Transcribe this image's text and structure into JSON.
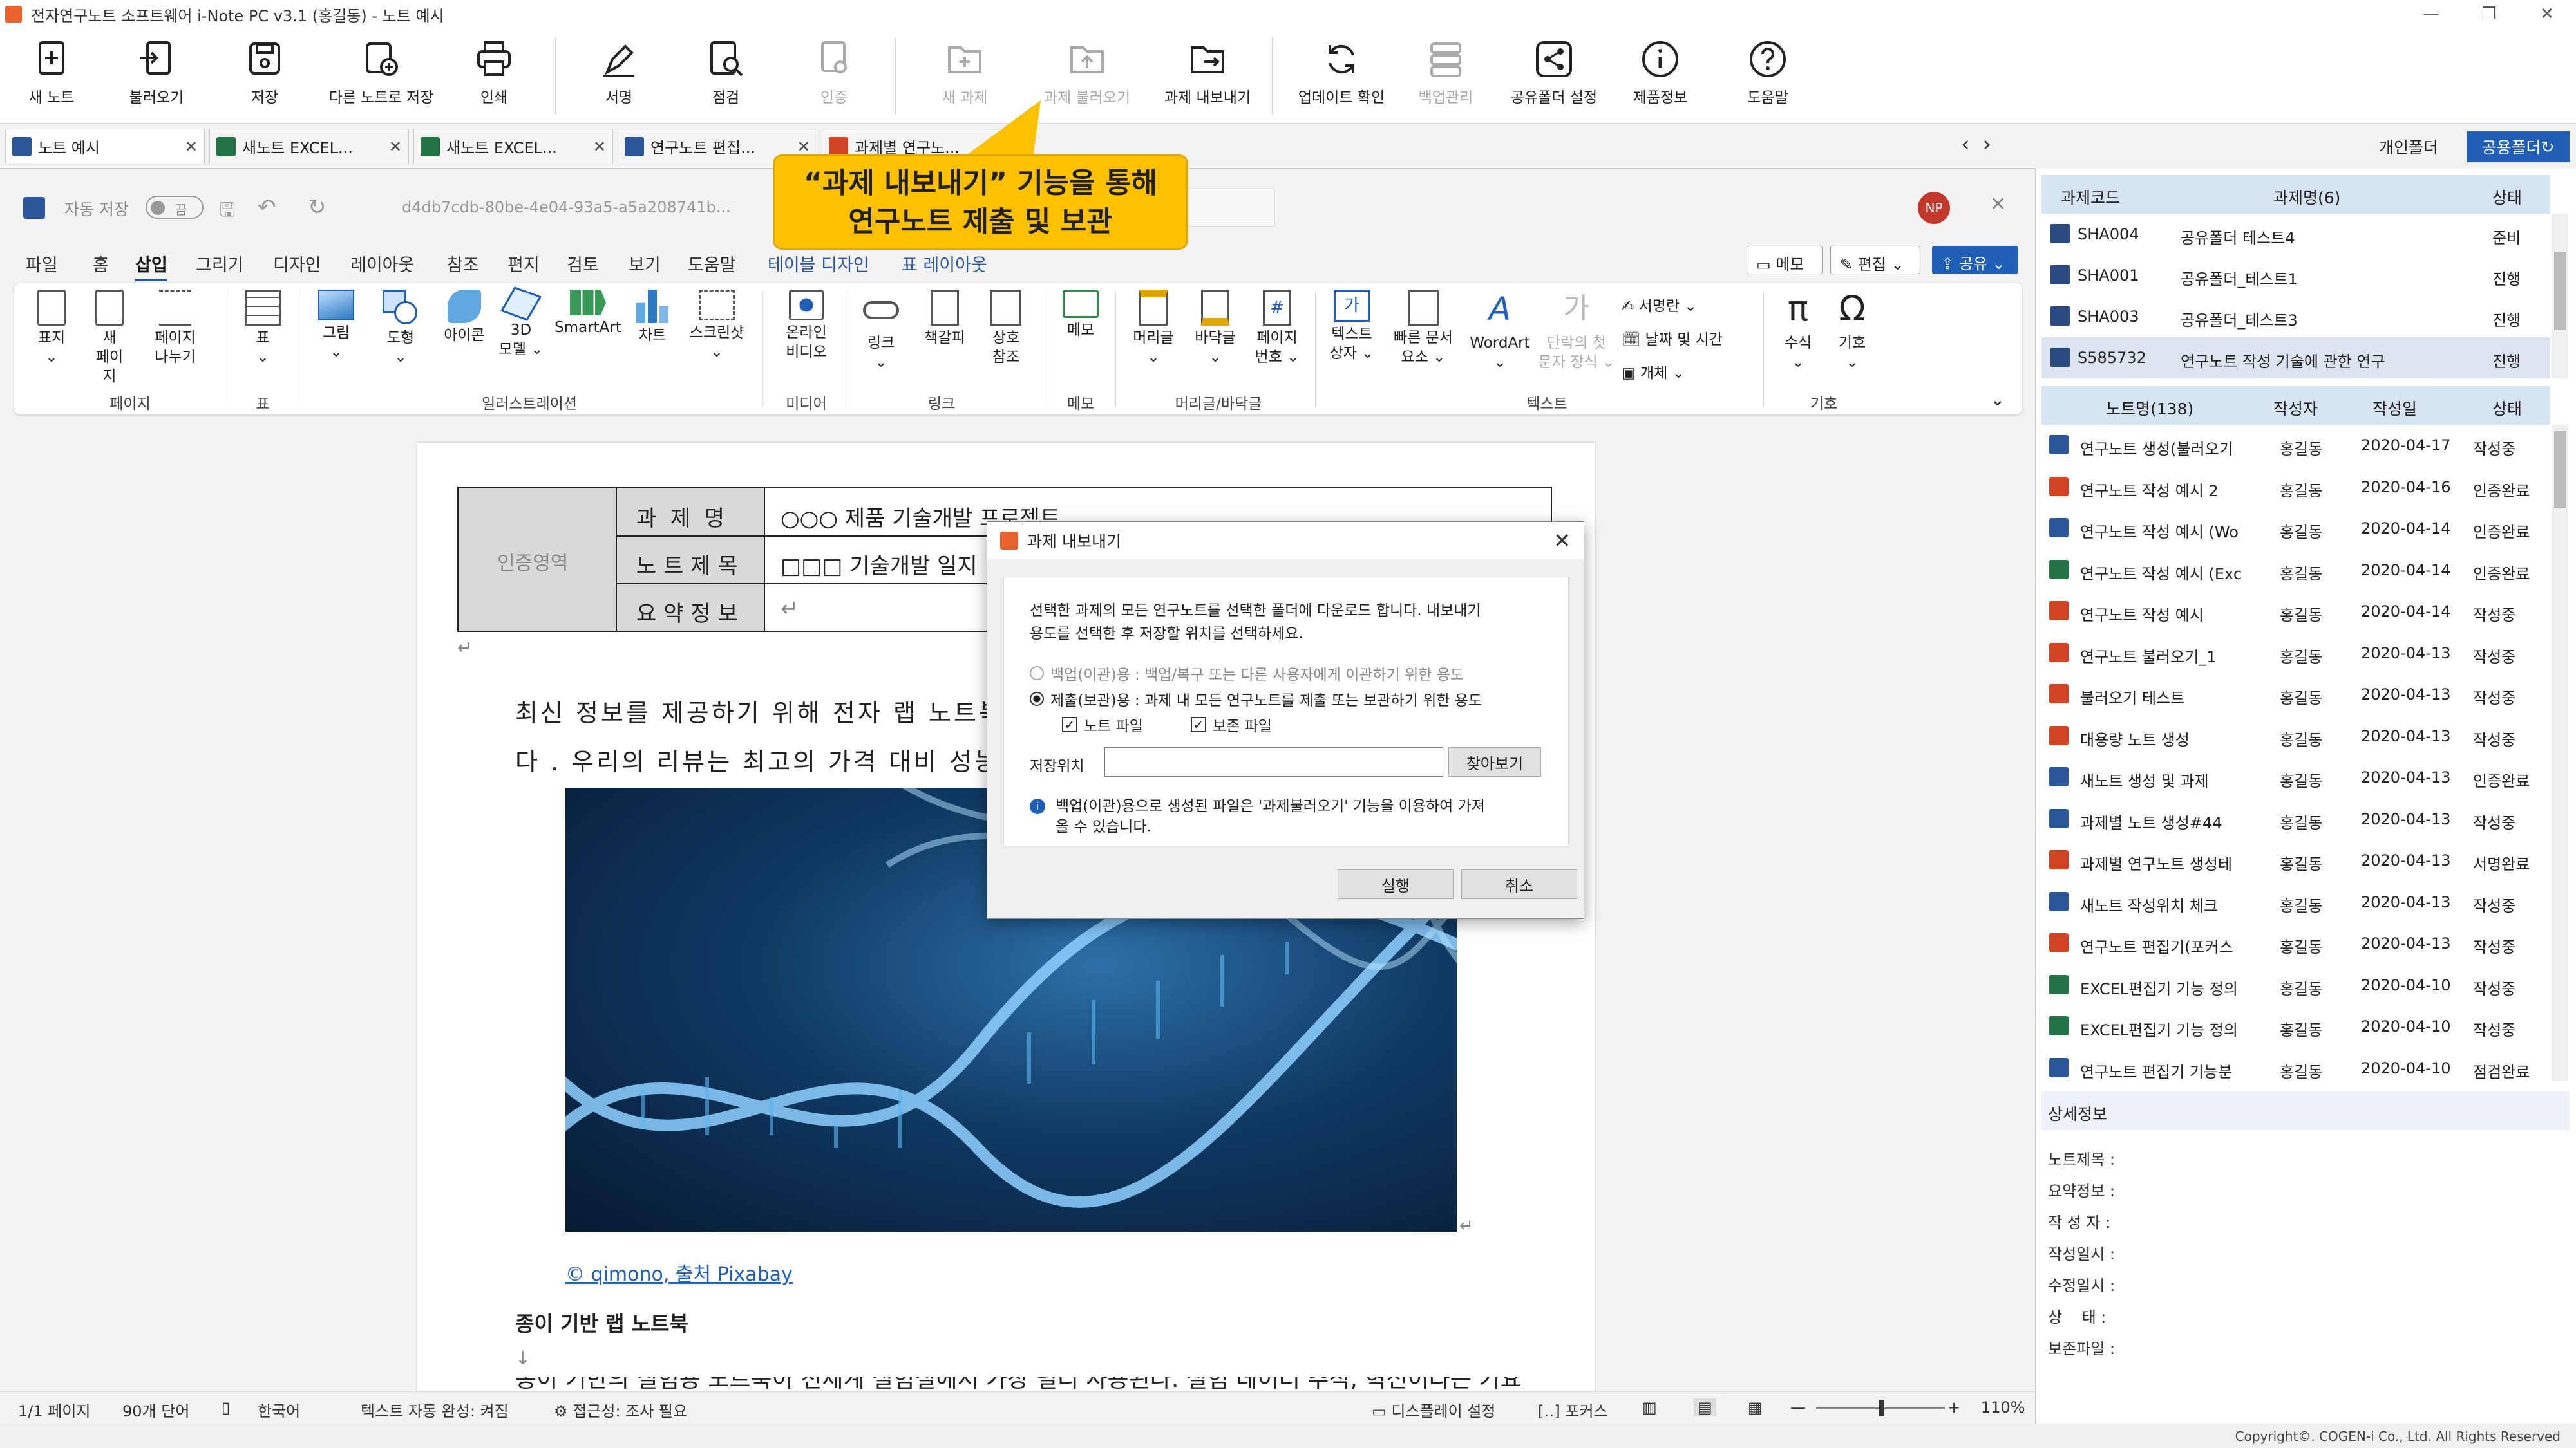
{
  "window": {
    "title": "전자연구노트 소프트웨어 i-Note PC v3.1 (홍길동) - 노트 예시",
    "minimize": "—",
    "maximize": "❐",
    "close": "✕"
  },
  "toolbar": {
    "buttons": [
      {
        "label": "새 노트",
        "icon": "new-note-icon"
      },
      {
        "label": "불러오기",
        "icon": "import-icon"
      },
      {
        "label": "저장",
        "icon": "save-icon"
      },
      {
        "label": "다른 노트로 저장",
        "icon": "save-as-icon"
      },
      {
        "label": "인쇄",
        "icon": "print-icon"
      },
      {
        "label": "서명",
        "icon": "sign-icon"
      },
      {
        "label": "점검",
        "icon": "inspect-icon"
      },
      {
        "label": "인증",
        "icon": "certify-icon"
      },
      {
        "label": "새 과제",
        "icon": "new-project-icon"
      },
      {
        "label": "과제 불러오기",
        "icon": "import-project-icon"
      },
      {
        "label": "과제 내보내기",
        "icon": "export-project-icon"
      },
      {
        "label": "업데이트 확인",
        "icon": "update-icon"
      },
      {
        "label": "백업관리",
        "icon": "backup-icon"
      },
      {
        "label": "공유폴더 설정",
        "icon": "share-icon"
      },
      {
        "label": "제품정보",
        "icon": "info-icon"
      },
      {
        "label": "도움말",
        "icon": "help-icon"
      }
    ]
  },
  "callout": {
    "line1": "“과제 내보내기” 기능을 통해",
    "line2": "연구노트 제출 및 보관"
  },
  "tabs": [
    {
      "label": "노트 예시",
      "type": "word"
    },
    {
      "label": "새노트 EXCEL...",
      "type": "excel"
    },
    {
      "label": "새노트 EXCEL...",
      "type": "excel"
    },
    {
      "label": "연구노트 편집...",
      "type": "word"
    },
    {
      "label": "과제별 연구노...",
      "type": "ppt"
    }
  ],
  "word": {
    "autosave_label": "자동 저장",
    "autosave_state": "끔",
    "filename": "d4db7cdb-80be-4e04-93a5-a5a208741b...",
    "avatar": "NP",
    "ribbon_tabs": [
      "파일",
      "홈",
      "삽입",
      "그리기",
      "디자인",
      "레이아웃",
      "참조",
      "편지",
      "검토",
      "보기",
      "도움말",
      "테이블 디자인",
      "표 레이아웃"
    ],
    "memo_btn": "메모",
    "edit_btn": "편집",
    "share_btn": "공유",
    "ribbon_groups": [
      "페이지",
      "표",
      "일러스트레이션",
      "미디어",
      "링크",
      "메모",
      "머리글/바닥글",
      "텍스트",
      "기호"
    ],
    "ribbon_items": {
      "cover": "표지",
      "new_page_1": "새",
      "new_page_2": "페이지",
      "page_break_1": "페이지",
      "page_break_2": "나누기",
      "table": "표",
      "picture": "그림",
      "shape": "도형",
      "icons": "아이콘",
      "model3d_1": "3D",
      "model3d_2": "모델",
      "smartart": "SmartArt",
      "chart": "차트",
      "screenshot": "스크린샷",
      "online_video_1": "온라인",
      "online_video_2": "비디오",
      "link": "링크",
      "bookmark": "책갈피",
      "cross_ref_1": "상호",
      "cross_ref_2": "참조",
      "comment": "메모",
      "header": "머리글",
      "footer": "바닥글",
      "page_number_1": "페이지",
      "page_number_2": "번호",
      "textbox_1": "텍스트",
      "textbox_2": "상자",
      "quick_parts_1": "빠른 문서",
      "quick_parts_2": "요소",
      "wordart": "WordArt",
      "dropcap_1": "단락의 첫",
      "dropcap_2": "문자 장식",
      "signature": "서명란",
      "datetime": "날짜 및 시간",
      "object": "개체",
      "equation": "수식",
      "symbol": "기호"
    }
  },
  "document": {
    "table": {
      "left_label": "인증영역",
      "rows": [
        {
          "label": "과  제  명",
          "value": "○○○ 제품 기술개발 프로젝트"
        },
        {
          "label": "노 트 제 목",
          "value": "□□□ 기술개발 일지"
        },
        {
          "label": "요 약 정 보",
          "value": ""
        }
      ]
    },
    "paragraph_line1": "최신 정보를 제공하기 위해 전자 랩 노트북",
    "paragraph_line2": "다 . 우리의 리뷰는 최고의 가격 대비 성능을",
    "image_credit": "© qimono, 출처 Pixabay",
    "section_title": "종이 기반 랩 노트북",
    "para_mark": "↵",
    "para_mark_down": "↓",
    "cutoff_line": "종이 기반의 실험용 노트북이 전세계 실험실에서 가장 널리 사용된다. 실험 데이터 추적, 혁신이라는 기요"
  },
  "status_bar": {
    "page": "1/1 페이지",
    "words": "90개 단어",
    "language": "한국어",
    "autocomplete": "텍스트 자동 완성: 켜짐",
    "accessibility": "접근성: 조사 필요",
    "display_settings": "디스플레이 설정",
    "focus": "포커스",
    "zoom": "110%"
  },
  "dialog": {
    "title": "과제 내보내기",
    "close": "✕",
    "description_line1": "선택한 과제의 모든 연구노트를 선택한 폴더에 다운로드 합니다. 내보내기",
    "description_line2": "용도를 선택한 후 저장할 위치를 선택하세요.",
    "option_backup": "백업(이관)용 : 백업/복구 또는 다른 사용자에게 이관하기 위한 용도",
    "option_submit": "제출(보관)용 : 과제 내 모든 연구노트를 제출 또는 보관하기 위한 용도",
    "selected_option": "submit",
    "check_note_file": "노트 파일",
    "check_preserve_file": "보존 파일",
    "save_location_label": "저장위치",
    "save_location_value": "",
    "browse_button": "찾아보기",
    "info_line1": "백업(이관)용으로 생성된 파일은 '과제불러오기' 기능을 이용하여 가져",
    "info_line2": "올 수 있습니다.",
    "ok_button": "실행",
    "cancel_button": "취소"
  },
  "right_panel": {
    "tab_personal": "개인폴더",
    "tab_shared": "공용폴더",
    "projects_header": {
      "code": "과제코드",
      "name": "과제명(6)",
      "status": "상태"
    },
    "projects": [
      {
        "code": "SHA004",
        "name": "공유폴더 테스트4",
        "status": "준비"
      },
      {
        "code": "SHA001",
        "name": "공유폴더_테스트1",
        "status": "진행"
      },
      {
        "code": "SHA003",
        "name": "공유폴더_테스트3",
        "status": "진행"
      },
      {
        "code": "S585732",
        "name": "연구노트 작성 기술에 관한 연구",
        "status": "진행"
      }
    ],
    "notes_header": {
      "name": "노트명(138)",
      "author": "작성자",
      "date": "작성일",
      "status": "상태"
    },
    "notes": [
      {
        "type": "word",
        "name": "연구노트 생성(불러오기",
        "author": "홍길동",
        "date": "2020-04-17",
        "status": "작성중"
      },
      {
        "type": "ppt",
        "name": "연구노트 작성 예시 2",
        "author": "홍길동",
        "date": "2020-04-16",
        "status": "인증완료"
      },
      {
        "type": "word",
        "name": "연구노트 작성 예시 (Wo",
        "author": "홍길동",
        "date": "2020-04-14",
        "status": "인증완료"
      },
      {
        "type": "excel",
        "name": "연구노트 작성 예시 (Exc",
        "author": "홍길동",
        "date": "2020-04-14",
        "status": "인증완료"
      },
      {
        "type": "ppt",
        "name": "연구노트 작성 예시",
        "author": "홍길동",
        "date": "2020-04-14",
        "status": "작성중"
      },
      {
        "type": "ppt",
        "name": "연구노트 불러오기_1",
        "author": "홍길동",
        "date": "2020-04-13",
        "status": "작성중"
      },
      {
        "type": "ppt",
        "name": "불러오기 테스트",
        "author": "홍길동",
        "date": "2020-04-13",
        "status": "작성중"
      },
      {
        "type": "ppt",
        "name": "대용량 노트 생성",
        "author": "홍길동",
        "date": "2020-04-13",
        "status": "작성중"
      },
      {
        "type": "word",
        "name": "새노트 생성 및 과제",
        "author": "홍길동",
        "date": "2020-04-13",
        "status": "인증완료"
      },
      {
        "type": "word",
        "name": "과제별 노트 생성#44",
        "author": "홍길동",
        "date": "2020-04-13",
        "status": "작성중"
      },
      {
        "type": "ppt",
        "name": "과제별 연구노트 생성테",
        "author": "홍길동",
        "date": "2020-04-13",
        "status": "서명완료"
      },
      {
        "type": "word",
        "name": "새노트 작성위치 체크",
        "author": "홍길동",
        "date": "2020-04-13",
        "status": "작성중"
      },
      {
        "type": "ppt",
        "name": "연구노트 편집기(포커스",
        "author": "홍길동",
        "date": "2020-04-13",
        "status": "작성중"
      },
      {
        "type": "excel",
        "name": "EXCEL편집기 기능 정의",
        "author": "홍길동",
        "date": "2020-04-10",
        "status": "작성중"
      },
      {
        "type": "excel",
        "name": "EXCEL편집기 기능 정의",
        "author": "홍길동",
        "date": "2020-04-10",
        "status": "작성중"
      },
      {
        "type": "word",
        "name": "연구노트 편집기 기능분",
        "author": "홍길동",
        "date": "2020-04-10",
        "status": "점검완료"
      }
    ],
    "detail_title": "상세정보",
    "detail_fields": [
      "노트제목 :",
      "요약정보 :",
      "작 성 자 :",
      "작성일시 :",
      "수정일시 :",
      "상    태 :",
      "보존파일 :"
    ],
    "copyright": "Copyright©. COGEN-i Co., Ltd. All Rights Reserved"
  },
  "colors": {
    "word": "#2b579a",
    "excel": "#217346",
    "ppt": "#d04423",
    "callout": "#ffc000",
    "header_blue": "#d6e4f3",
    "selected_row": "#dbe4ef",
    "shared_tab": "#1f5fb8"
  }
}
